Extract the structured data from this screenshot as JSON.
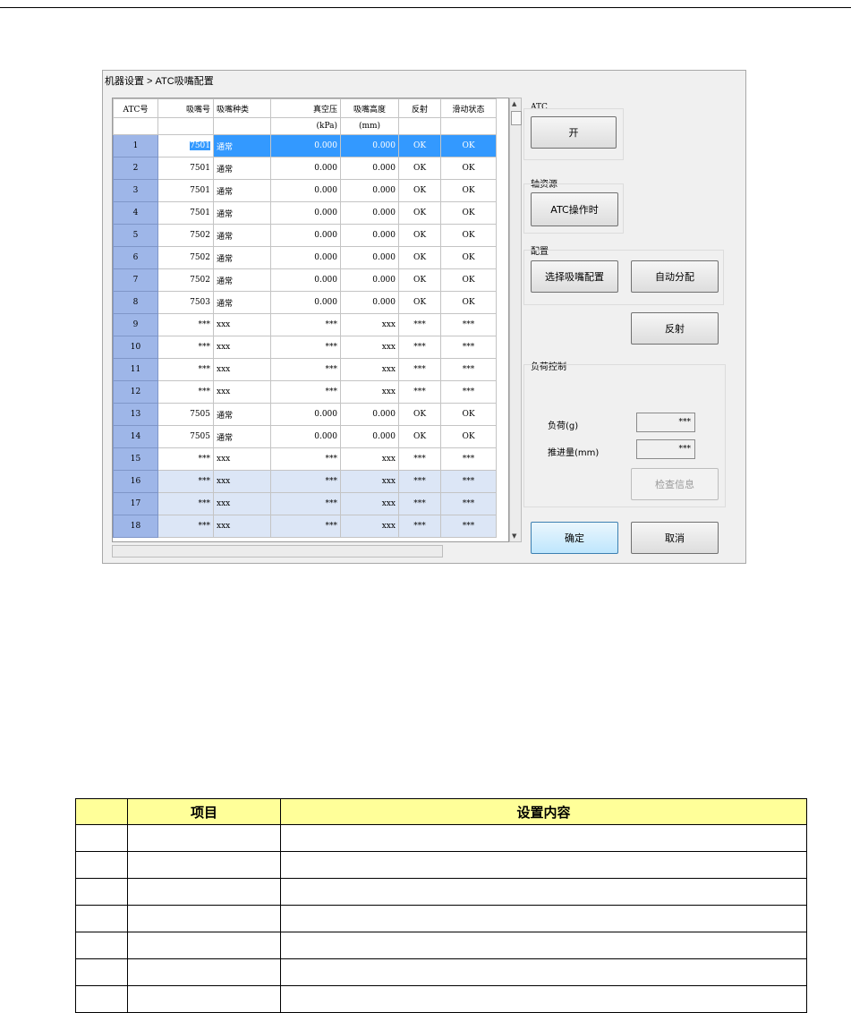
{
  "dialog": {
    "title": "机器设置 > ATC吸嘴配置",
    "grid": {
      "headers": [
        "ATC号",
        "吸嘴号",
        "吸嘴种类",
        "真空压",
        "吸嘴高度",
        "反射",
        "滑动状态"
      ],
      "units": [
        "",
        "",
        "",
        "(kPa)",
        "(mm)",
        "",
        ""
      ],
      "rows": [
        {
          "atc": "1",
          "nozzle": "7501",
          "type": "通常",
          "vacuum": "0.000",
          "height": "0.000",
          "reflect": "OK",
          "slide": "OK"
        },
        {
          "atc": "2",
          "nozzle": "7501",
          "type": "通常",
          "vacuum": "0.000",
          "height": "0.000",
          "reflect": "OK",
          "slide": "OK"
        },
        {
          "atc": "3",
          "nozzle": "7501",
          "type": "通常",
          "vacuum": "0.000",
          "height": "0.000",
          "reflect": "OK",
          "slide": "OK"
        },
        {
          "atc": "4",
          "nozzle": "7501",
          "type": "通常",
          "vacuum": "0.000",
          "height": "0.000",
          "reflect": "OK",
          "slide": "OK"
        },
        {
          "atc": "5",
          "nozzle": "7502",
          "type": "通常",
          "vacuum": "0.000",
          "height": "0.000",
          "reflect": "OK",
          "slide": "OK"
        },
        {
          "atc": "6",
          "nozzle": "7502",
          "type": "通常",
          "vacuum": "0.000",
          "height": "0.000",
          "reflect": "OK",
          "slide": "OK"
        },
        {
          "atc": "7",
          "nozzle": "7502",
          "type": "通常",
          "vacuum": "0.000",
          "height": "0.000",
          "reflect": "OK",
          "slide": "OK"
        },
        {
          "atc": "8",
          "nozzle": "7503",
          "type": "通常",
          "vacuum": "0.000",
          "height": "0.000",
          "reflect": "OK",
          "slide": "OK"
        },
        {
          "atc": "9",
          "nozzle": "***",
          "type": "xxx",
          "vacuum": "***",
          "height": "xxx",
          "reflect": "***",
          "slide": "***"
        },
        {
          "atc": "10",
          "nozzle": "***",
          "type": "xxx",
          "vacuum": "***",
          "height": "xxx",
          "reflect": "***",
          "slide": "***"
        },
        {
          "atc": "11",
          "nozzle": "***",
          "type": "xxx",
          "vacuum": "***",
          "height": "xxx",
          "reflect": "***",
          "slide": "***"
        },
        {
          "atc": "12",
          "nozzle": "***",
          "type": "xxx",
          "vacuum": "***",
          "height": "xxx",
          "reflect": "***",
          "slide": "***"
        },
        {
          "atc": "13",
          "nozzle": "7505",
          "type": "通常",
          "vacuum": "0.000",
          "height": "0.000",
          "reflect": "OK",
          "slide": "OK"
        },
        {
          "atc": "14",
          "nozzle": "7505",
          "type": "通常",
          "vacuum": "0.000",
          "height": "0.000",
          "reflect": "OK",
          "slide": "OK"
        },
        {
          "atc": "15",
          "nozzle": "***",
          "type": "xxx",
          "vacuum": "***",
          "height": "xxx",
          "reflect": "***",
          "slide": "***"
        },
        {
          "atc": "16",
          "nozzle": "***",
          "type": "xxx",
          "vacuum": "***",
          "height": "xxx",
          "reflect": "***",
          "slide": "***"
        },
        {
          "atc": "17",
          "nozzle": "***",
          "type": "xxx",
          "vacuum": "***",
          "height": "xxx",
          "reflect": "***",
          "slide": "***"
        },
        {
          "atc": "18",
          "nozzle": "***",
          "type": "xxx",
          "vacuum": "***",
          "height": "xxx",
          "reflect": "***",
          "slide": "***"
        }
      ]
    },
    "atc_group": {
      "label": "ATC",
      "button": "开"
    },
    "axis_group": {
      "label": "轴资源",
      "button": "ATC操作时"
    },
    "config_group": {
      "label": "配置",
      "select_button": "选择吸嘴配置",
      "auto_button": "自动分配"
    },
    "reflect_button": "反射",
    "load_group": {
      "label": "负荷控制",
      "load_label": "负荷(g)",
      "load_value": "***",
      "push_label": "推进量(mm)",
      "push_value": "***",
      "check_button": "检查信息"
    },
    "ok_button": "确定",
    "cancel_button": "取消"
  },
  "doc_table": {
    "headers": [
      "",
      "项目",
      "设置内容"
    ],
    "row_count": 7
  },
  "colors": {
    "atc_cell": "#9eb6e8",
    "selection": "#3399ff",
    "alt_row": "#dce6f6",
    "doc_header": "#ffff99"
  }
}
